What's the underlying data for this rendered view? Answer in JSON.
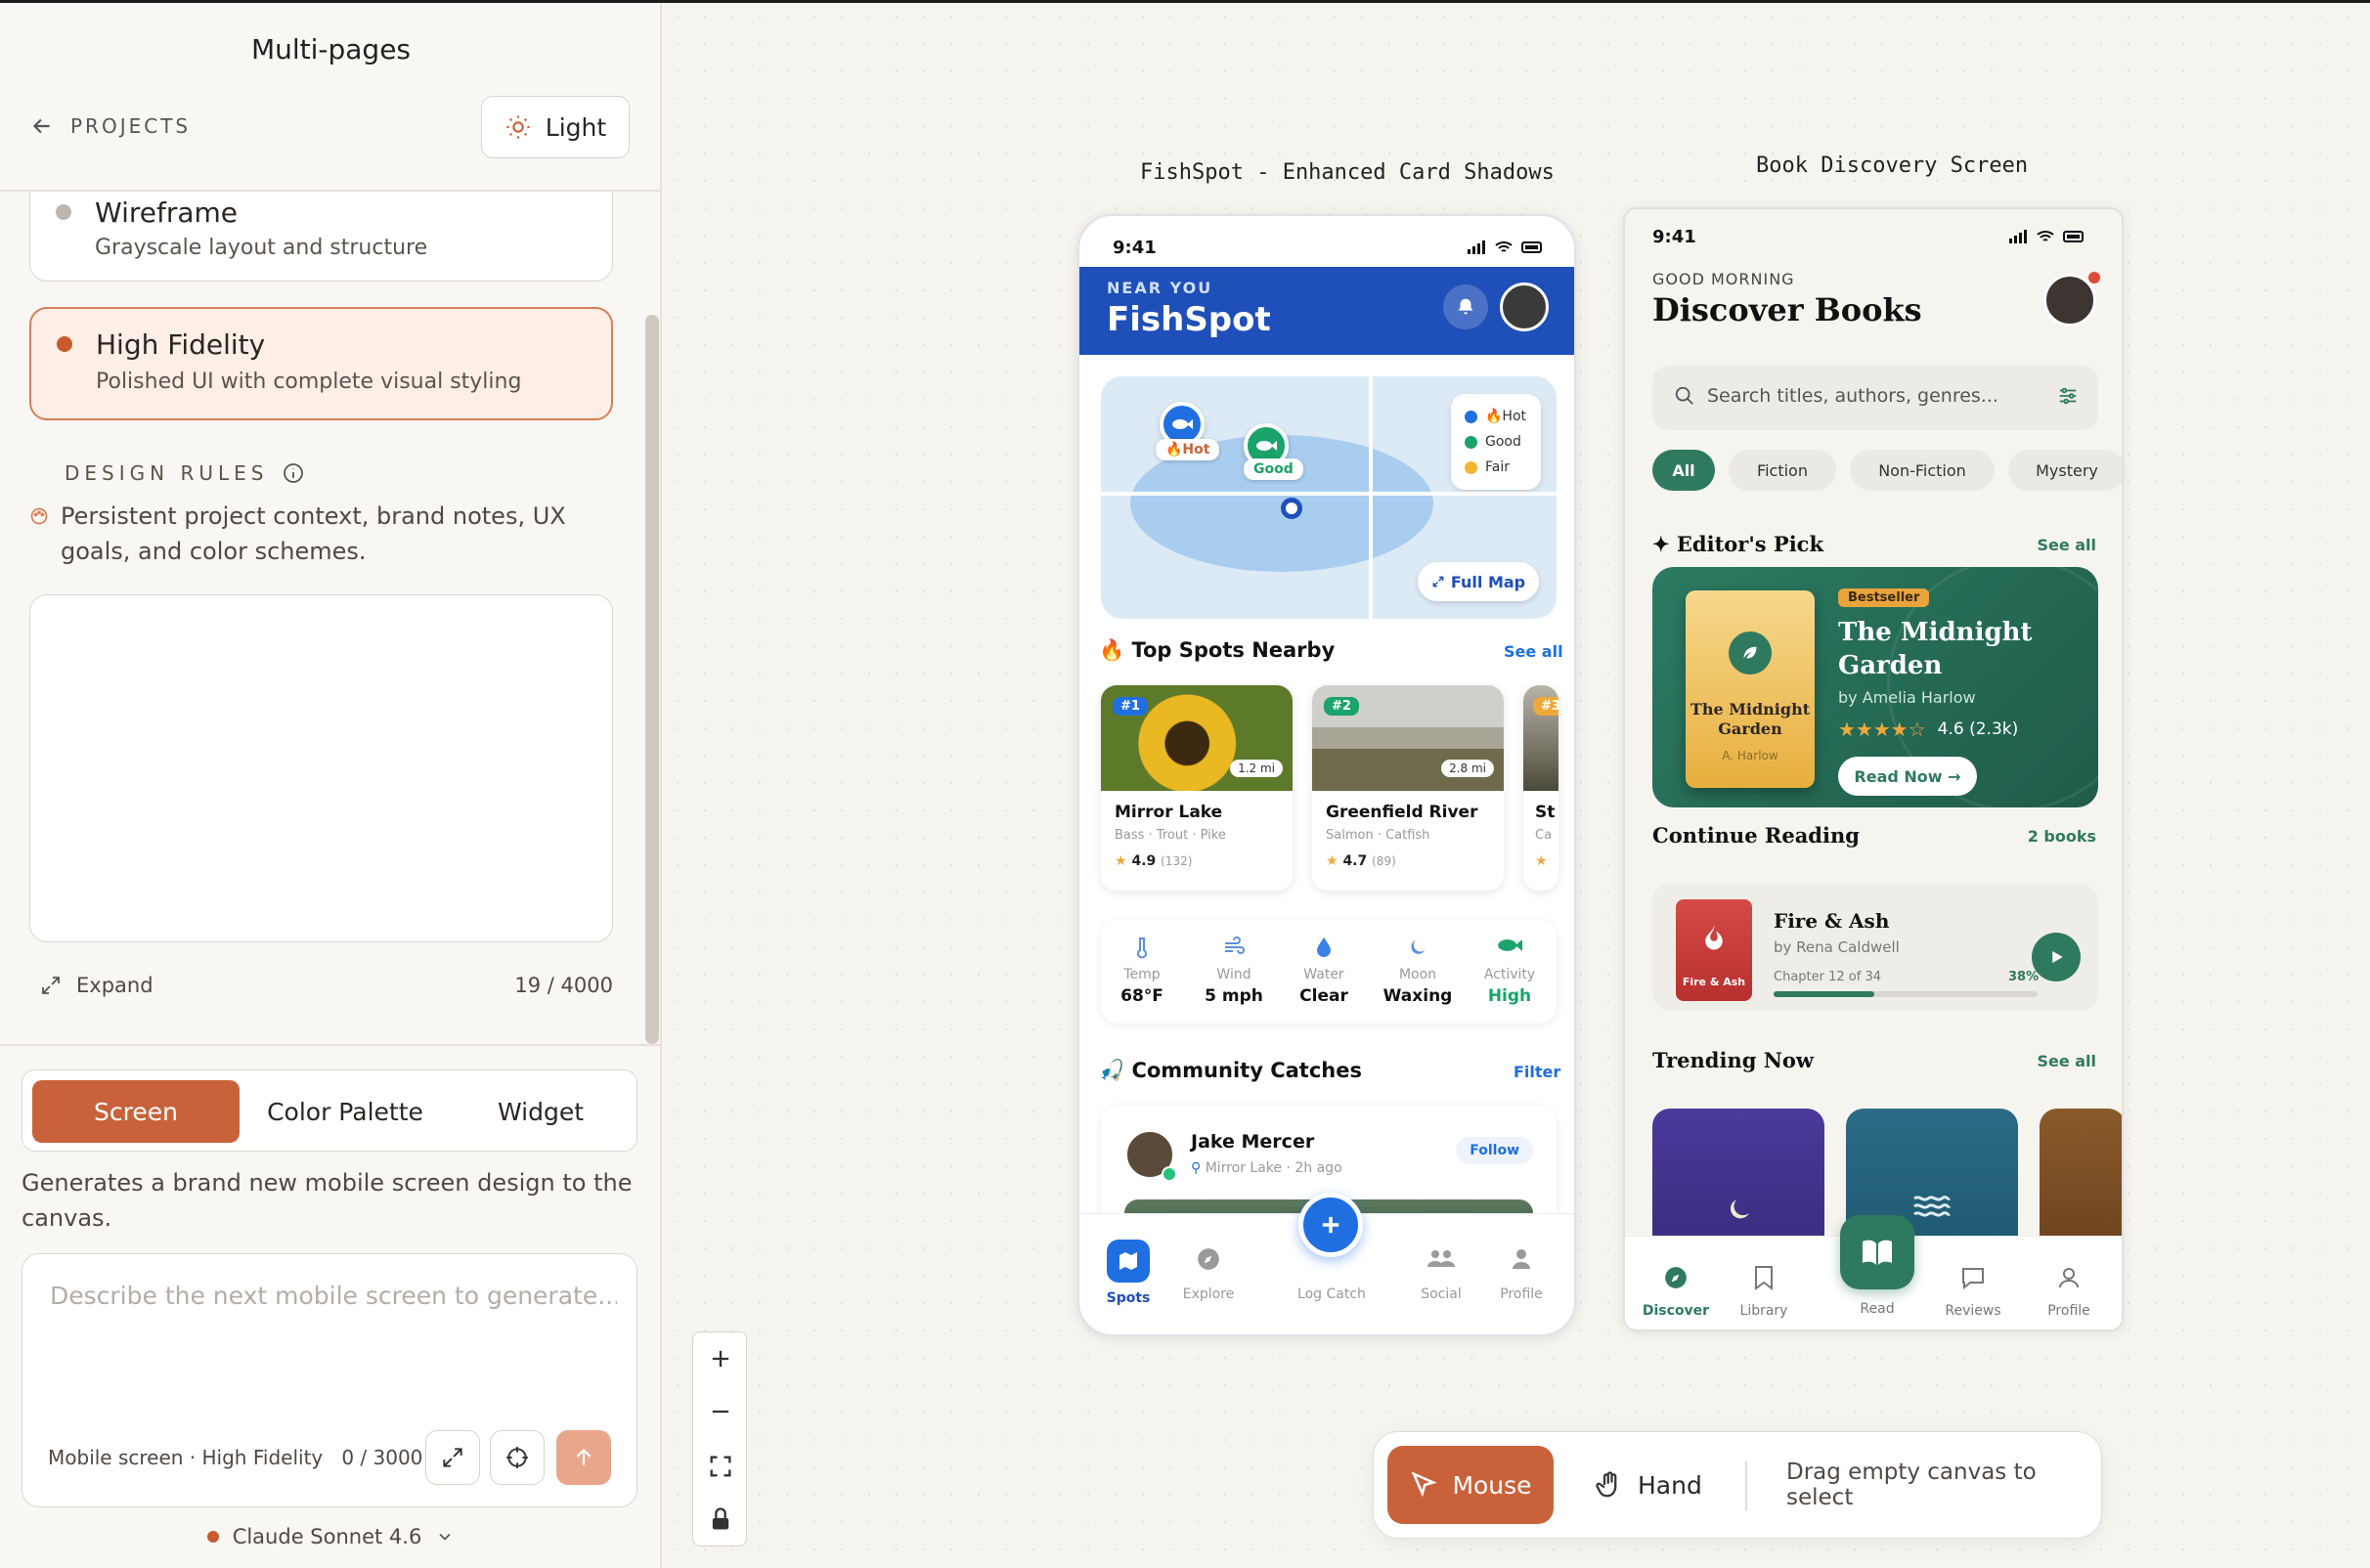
{
  "sidebar": {
    "title": "Multi-pages",
    "back_label": "PROJECTS",
    "theme_button": "Light",
    "fidelity_options": [
      {
        "title": "Wireframe",
        "subtitle": "Grayscale layout and structure"
      },
      {
        "title": "High Fidelity",
        "subtitle": "Polished UI with complete visual styling"
      }
    ],
    "design_rules_label": "DESIGN RULES",
    "design_rules_desc": "Persistent project context, brand notes, UX goals, and color schemes.",
    "expand_label": "Expand",
    "rules_counter": "19 / 4000",
    "tabs": [
      "Screen",
      "Color Palette",
      "Widget"
    ],
    "generate_desc": "Generates a brand new mobile screen design to the canvas.",
    "prompt_placeholder": "Describe the next mobile screen to generate...",
    "prompt_meta": "Mobile screen · High Fidelity",
    "prompt_counter": "0 / 3000",
    "model": "Claude Sonnet 4.6"
  },
  "canvas": {
    "frame1_label": "FishSpot - Enhanced Card Shadows",
    "frame2_label": "Book Discovery Screen",
    "toolbar": {
      "mouse": "Mouse",
      "hand": "Hand",
      "hint": "Drag empty canvas to select"
    }
  },
  "fishspot": {
    "time": "9:41",
    "near_label": "NEAR YOU",
    "brand": "FishSpot",
    "pins": {
      "hot": "🔥Hot",
      "good": "Good"
    },
    "legend": [
      "🔥Hot",
      "Good",
      "Fair"
    ],
    "full_map": "Full Map",
    "top_spots_title": "🔥 Top Spots Nearby",
    "see_all": "See all",
    "spots": [
      {
        "rank": "#1",
        "dist": "1.2 mi",
        "name": "Mirror Lake",
        "fish": "Bass · Trout · Pike",
        "rating": "4.9",
        "reviews": "(132)"
      },
      {
        "rank": "#2",
        "dist": "2.8 mi",
        "name": "Greenfield River",
        "fish": "Salmon · Catfish",
        "rating": "4.7",
        "reviews": "(89)"
      },
      {
        "rank": "#3",
        "dist": "",
        "name": "St",
        "fish": "Ca",
        "rating": "",
        "reviews": ""
      }
    ],
    "conditions": [
      {
        "label": "Temp",
        "value": "68°F"
      },
      {
        "label": "Wind",
        "value": "5 mph"
      },
      {
        "label": "Water",
        "value": "Clear"
      },
      {
        "label": "Moon",
        "value": "Waxing"
      },
      {
        "label": "Activity",
        "value": "High"
      }
    ],
    "community_title": "🎣 Community Catches",
    "filter": "Filter",
    "post": {
      "name": "Jake Mercer",
      "meta": "Mirror Lake · 2h ago",
      "follow": "Follow"
    },
    "tabs": [
      "Spots",
      "Explore",
      "Log Catch",
      "Social",
      "Profile"
    ]
  },
  "books": {
    "time": "9:41",
    "greeting": "GOOD MORNING",
    "title": "Discover Books",
    "search_placeholder": "Search titles, authors, genres...",
    "chips": [
      "All",
      "Fiction",
      "Non-Fiction",
      "Mystery"
    ],
    "editors_pick": "✦ Editor's Pick",
    "see_all": "See all",
    "featured": {
      "badge": "Bestseller",
      "title": "The Midnight Garden",
      "author": "by Amelia Harlow",
      "cover_title": "The Midnight Garden",
      "cover_author": "A. Harlow",
      "stars": "★★★★☆",
      "rating": "4.6 (2.3k)",
      "rating_value": 4.6,
      "cta": "Read Now →"
    },
    "continue_title": "Continue Reading",
    "continue_count": "2 books",
    "current": {
      "cover_label": "Fire & Ash",
      "title": "Fire & Ash",
      "author": "by Rena Caldwell",
      "chapter": "Chapter 12 of 34",
      "progress": "38%",
      "progress_value": 0.38
    },
    "trending_title": "Trending Now",
    "tabs": [
      "Discover",
      "Library",
      "Read",
      "Reviews",
      "Profile"
    ]
  }
}
